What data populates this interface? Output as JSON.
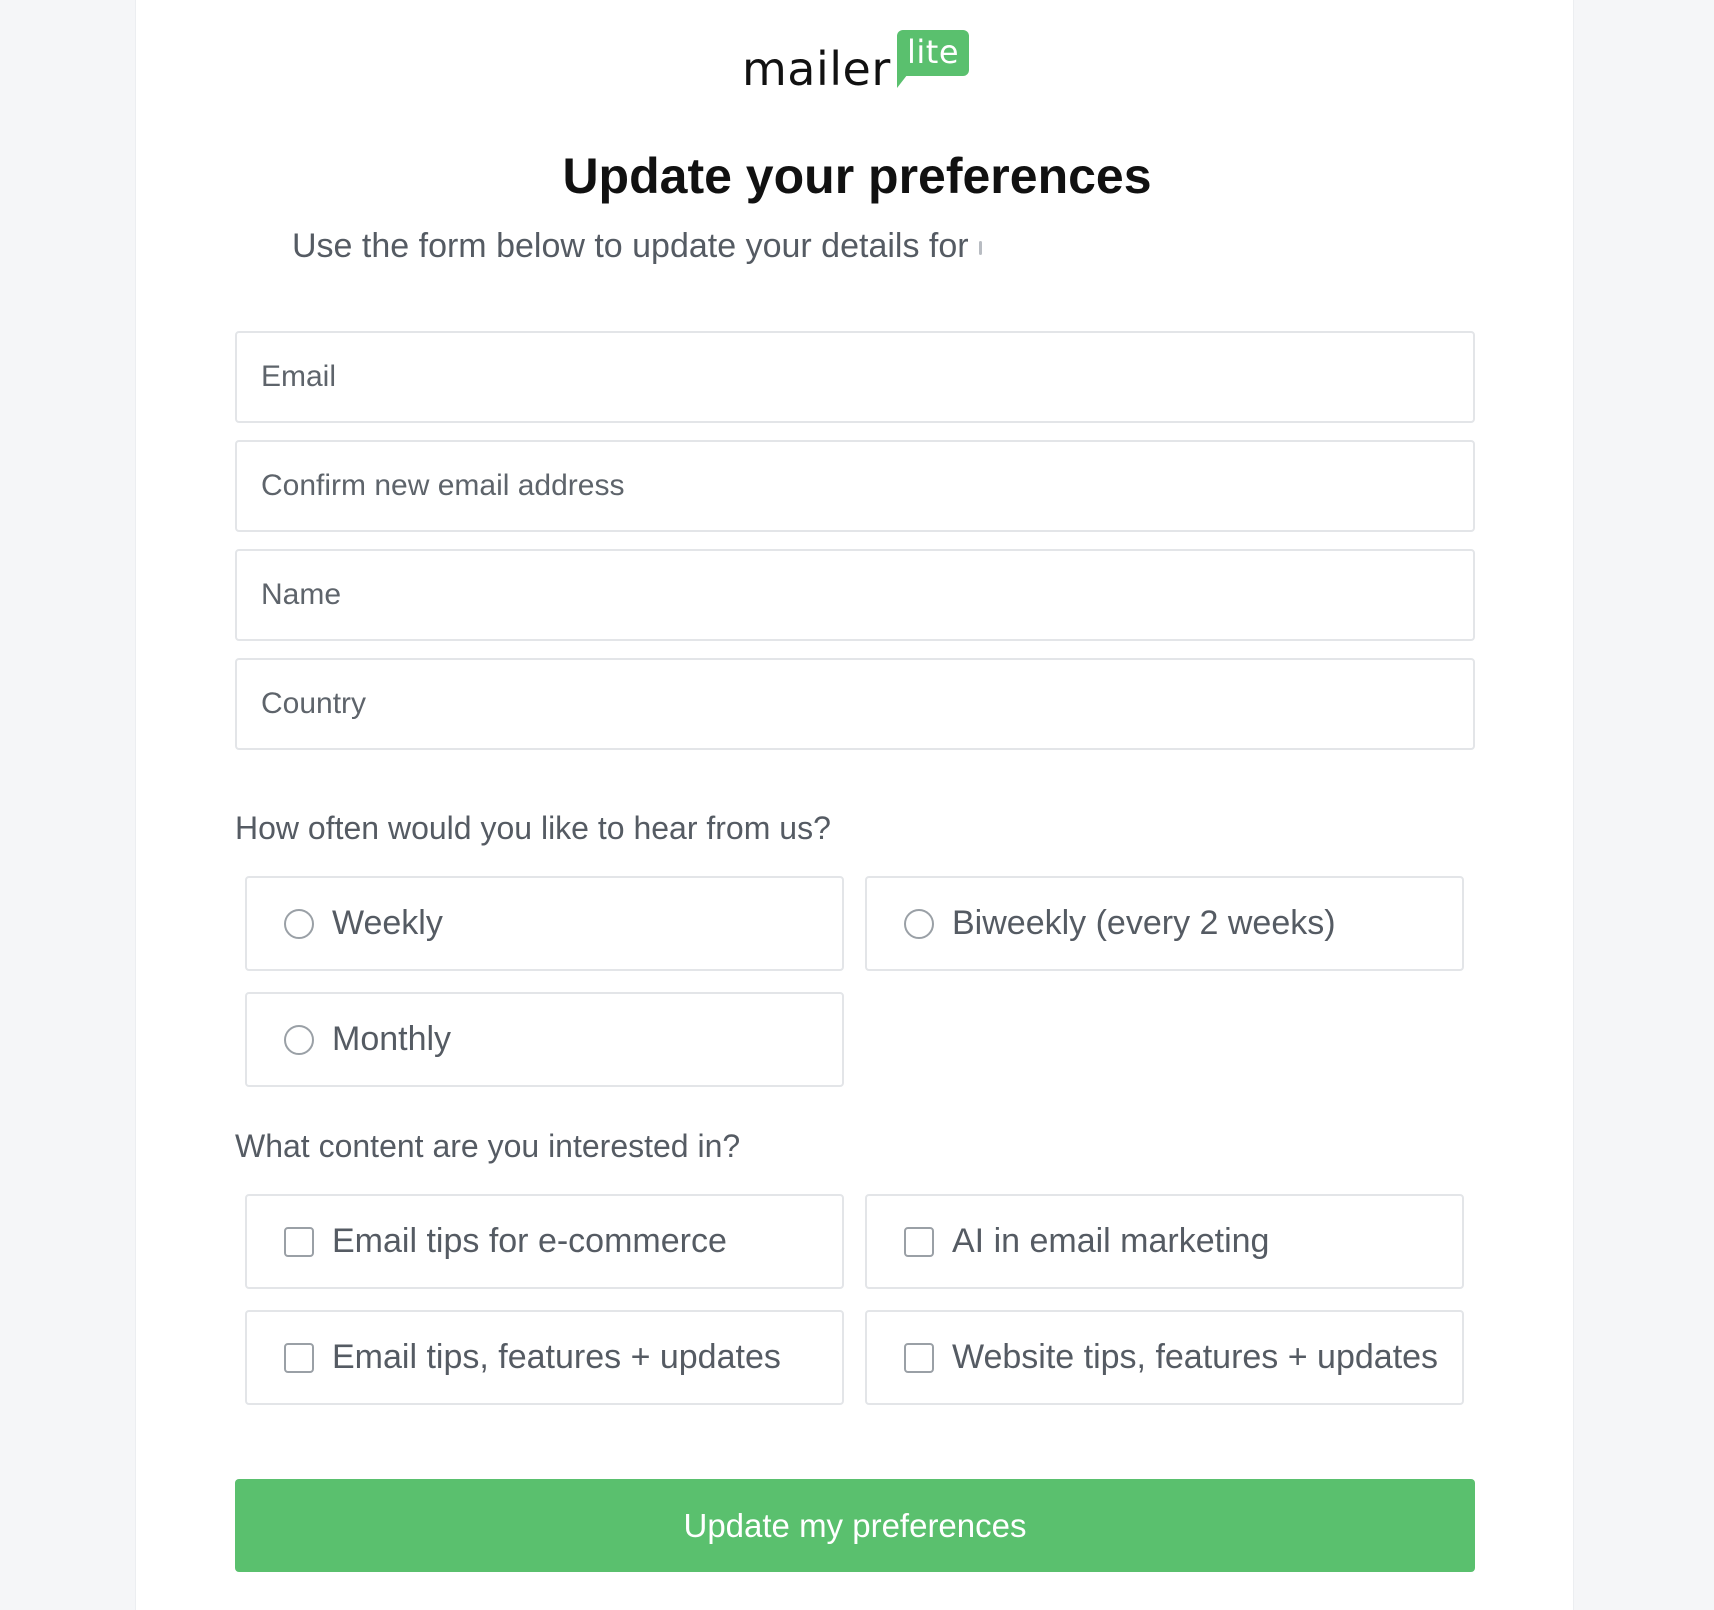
{
  "logo": {
    "word": "mailer",
    "badge": "lite",
    "badge_color": "#5ac06e"
  },
  "title": "Update your preferences",
  "subtitle": "Use the form below to update your details for",
  "fields": {
    "email_placeholder": "Email",
    "confirm_email_placeholder": "Confirm new email address",
    "name_placeholder": "Name",
    "country_placeholder": "Country"
  },
  "frequency": {
    "question": "How often would you like to hear from us?",
    "options": [
      {
        "label": "Weekly",
        "selected": false
      },
      {
        "label": "Biweekly (every 2 weeks)",
        "selected": false
      },
      {
        "label": "Monthly",
        "selected": false
      }
    ]
  },
  "interests": {
    "question": "What content are you interested in?",
    "options": [
      {
        "label": "Email tips for e-commerce",
        "checked": false
      },
      {
        "label": "AI in email marketing",
        "checked": false
      },
      {
        "label": "Email tips, features + updates",
        "checked": false
      },
      {
        "label": "Website tips, features + updates",
        "checked": false
      }
    ]
  },
  "submit_label": "Update my preferences",
  "colors": {
    "accent": "#5ac06e",
    "background": "#f5f6f8",
    "card": "#ffffff",
    "border": "#e3e5e8",
    "text_muted": "#555b63",
    "heading": "#111111"
  }
}
